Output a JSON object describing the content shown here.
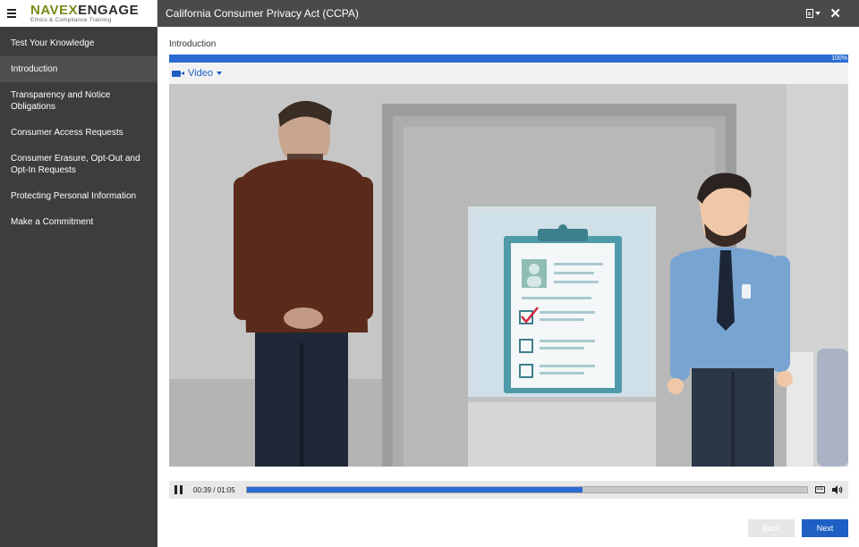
{
  "header": {
    "logo_brand_a": "NAVEX",
    "logo_brand_b": "ENGAGE",
    "logo_subtitle": "Ethics & Compliance Training",
    "title": "California Consumer Privacy Act (CCPA)"
  },
  "sidebar": {
    "items": [
      {
        "label": "Test Your Knowledge"
      },
      {
        "label": "Introduction"
      },
      {
        "label": "Transparency and Notice Obligations"
      },
      {
        "label": "Consumer Access Requests"
      },
      {
        "label": "Consumer Erasure, Opt-Out and Opt-In Requests"
      },
      {
        "label": "Protecting Personal Information"
      },
      {
        "label": "Make a Commitment"
      }
    ],
    "active_index": 1
  },
  "main": {
    "section_title": "Introduction",
    "progress_percent": 100,
    "progress_label": "100%",
    "media_tab": "Video",
    "player": {
      "time": "00:39 / 01:05",
      "played_fraction": 0.6
    },
    "buttons": {
      "back": "Back",
      "next": "Next"
    }
  },
  "colors": {
    "accent": "#1e5fc4",
    "sidebar_bg": "#3d3d3d",
    "topbar_bg": "#4a4a4a",
    "brand_green": "#7a8a1a"
  },
  "icons": {
    "menu": "hamburger-icon",
    "document": "document-icon",
    "close": "close-icon",
    "video": "camera-icon",
    "pause": "pause-icon",
    "captions": "closed-captions-icon",
    "volume": "volume-icon"
  }
}
